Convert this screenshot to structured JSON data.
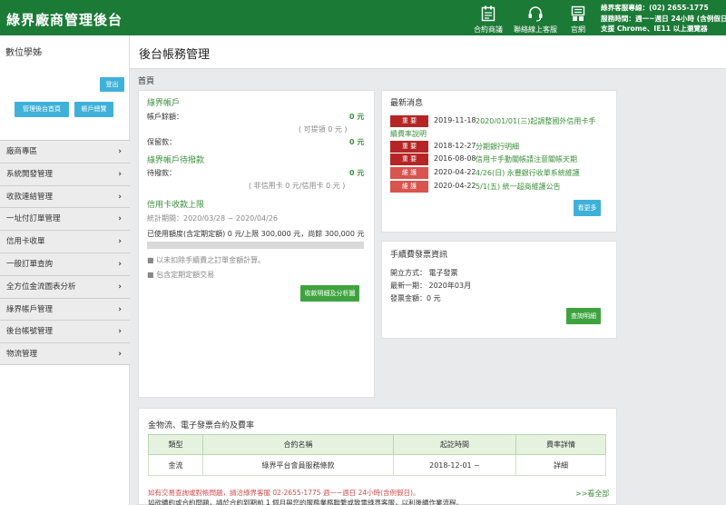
{
  "header": {
    "brand": "綠界廠商管理後台",
    "nav": [
      {
        "icon": "contract-icon",
        "label": "合約商議"
      },
      {
        "icon": "headset-icon",
        "label": "聯絡線上客服"
      },
      {
        "icon": "website-icon",
        "label": "官網"
      }
    ],
    "support_line1": "綠界客服專線：(02) 2655-1775",
    "support_line2": "服務時間：週一~週日 24小時 (含例假日)",
    "support_line3": "支援 Chrome、IE11 以上瀏覽器"
  },
  "sidebar": {
    "user": "數位學姊",
    "logout": "登出",
    "home_btn": "管理後台首頁",
    "account_btn": "帳戶總覽",
    "items": [
      {
        "label": "廠商專區"
      },
      {
        "label": "系統開發管理"
      },
      {
        "label": "收款連結管理"
      },
      {
        "label": "一址付訂單管理"
      },
      {
        "label": "信用卡收單"
      },
      {
        "label": "一般訂單查詢"
      },
      {
        "label": "全方位金流圖表分析"
      },
      {
        "label": "綠界帳戶管理"
      },
      {
        "label": "後台帳號管理"
      },
      {
        "label": "物流管理"
      }
    ]
  },
  "page": {
    "title": "後台帳務管理",
    "breadcrumb": "首頁"
  },
  "account": {
    "title": "綠界帳戶",
    "balance_label": "帳戶餘額：",
    "balance_value": "0 元",
    "withdrawable": "( 可提領 0 元 )",
    "reserve_label": "保留款：",
    "reserve_value": "0 元",
    "pending_title": "綠界帳戶待撥款",
    "pending_label": "待撥款：",
    "pending_value": "0 元",
    "pending_note": "( 非信用卡 0 元/信用卡 0 元 )",
    "limit_title": "信用卡收款上限",
    "period": "統計期間：2020/03/28 ~ 2020/04/26",
    "used": "已使用額度(含定期定額) 0 元/上限 300,000 元，尚餘 300,000 元",
    "used_fraction": 0,
    "note1": "以未扣除手續費之訂單金額計算。",
    "note2": "包含定期定額交易",
    "detail_btn": "收款明細及分析圖"
  },
  "news": {
    "title": "最新消息",
    "items": [
      {
        "badge": "重 要",
        "type": "important",
        "date": "2019-11-18",
        "text": "2020/01/01(三)起調整國外信用卡手",
        "text2": "續費率說明"
      },
      {
        "badge": "重 要",
        "type": "important",
        "date": "2018-12-27",
        "text": "分期銀行明細"
      },
      {
        "badge": "重 要",
        "type": "important",
        "date": "2016-08-08",
        "text": "信用卡手動關帳請注意關帳天期"
      },
      {
        "badge": "維 護",
        "type": "maint",
        "date": "2020-04-22",
        "text": "4/26(日) 永豐銀行收單系統維護"
      },
      {
        "badge": "維 護",
        "type": "maint",
        "date": "2020-04-22",
        "text": "5/1(五) 統一超商維護公告"
      }
    ],
    "more_btn": "看更多"
  },
  "invoice": {
    "title": "手續費發票資訊",
    "method": "開立方式： 電子發票",
    "latest": "最新一期： 2020年03月",
    "amount": "發票金額：0 元",
    "query_btn": "查詢明細"
  },
  "contract": {
    "title": "金物流、電子發票合約及費率",
    "headers": [
      "類型",
      "合約名稱",
      "起訖時間",
      "費率詳情"
    ],
    "rows": [
      {
        "type": "金流",
        "name": "綠界平台會員服務條款",
        "period": "2018-12-01 ~",
        "detail": "詳細"
      }
    ],
    "notice1": "如有交易查詢或對帳問題，請洽綠界客服 02-2655-1775 週一~週日 24小時(含例假日)。",
    "notice2": "如欲續約或合約問題，請於合約到期前 1 個月與您的服務業務聯繫或致電綠界客服，以利後續作業流程。",
    "view_all": ">>看全部"
  },
  "colors": {
    "brand_green": "#1c7a37",
    "accent_green": "#3ea33e",
    "teal": "#3fb1d9",
    "badge_red": "#b52525"
  }
}
